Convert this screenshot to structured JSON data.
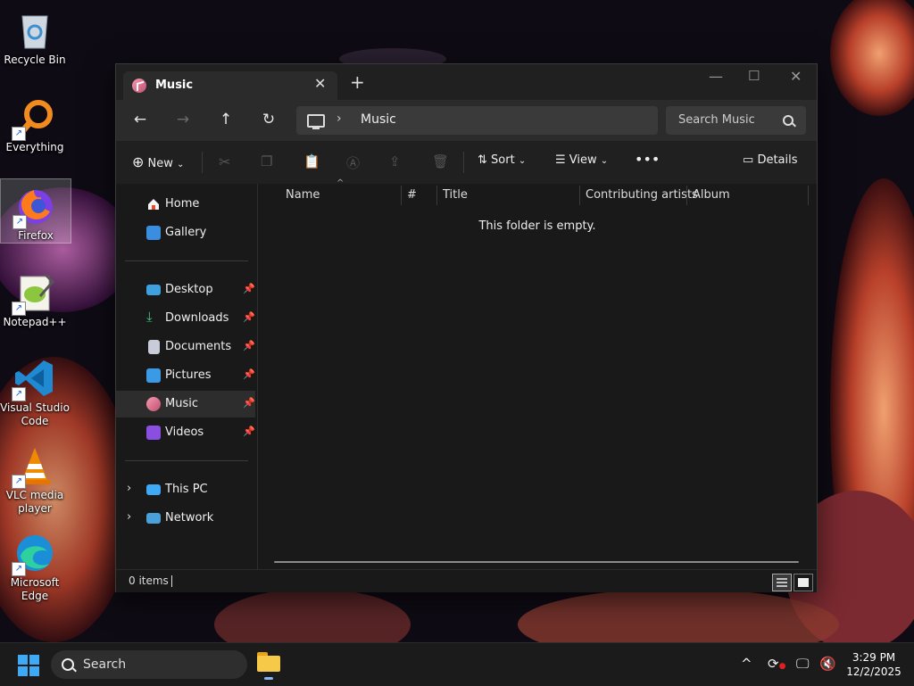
{
  "desktop": {
    "icons": [
      {
        "label": "Recycle Bin"
      },
      {
        "label": "Everything"
      },
      {
        "label": "Firefox"
      },
      {
        "label": "Notepad++"
      },
      {
        "label": "Visual Studio Code"
      },
      {
        "label": "VLC media player"
      },
      {
        "label": "Microsoft Edge"
      }
    ]
  },
  "window": {
    "tab": {
      "label": "Music",
      "icon": "music-icon"
    },
    "address": {
      "crumb": "Music"
    },
    "search": {
      "placeholder": "Search Music"
    },
    "commands": {
      "new": "New",
      "sort": "Sort",
      "view": "View",
      "details": "Details"
    },
    "sidebar": {
      "quick": [
        {
          "label": "Home"
        },
        {
          "label": "Gallery"
        }
      ],
      "pinned": [
        {
          "label": "Desktop"
        },
        {
          "label": "Downloads"
        },
        {
          "label": "Documents"
        },
        {
          "label": "Pictures"
        },
        {
          "label": "Music"
        },
        {
          "label": "Videos"
        }
      ],
      "tree": [
        {
          "label": "This PC"
        },
        {
          "label": "Network"
        }
      ]
    },
    "columns": [
      "Name",
      "#",
      "Title",
      "Contributing artists",
      "Album"
    ],
    "empty_message": "This folder is empty.",
    "status": {
      "count": "0 items"
    }
  },
  "taskbar": {
    "search_label": "Search",
    "time": "3:29 PM",
    "date": "12/2/2025"
  },
  "colors": {
    "accent": "#3fa9f5",
    "window_bg": "#191919",
    "selected": "#2d2d2d"
  }
}
